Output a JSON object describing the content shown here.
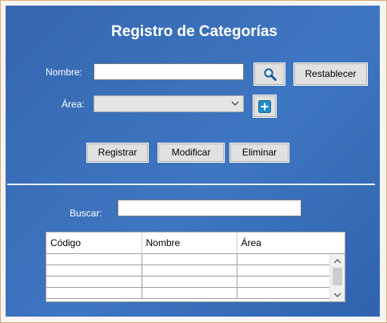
{
  "form": {
    "title": "Registro de Categorías",
    "nombre_label": "Nombre:",
    "nombre_value": "",
    "area_label": "Área:",
    "area_selected": "",
    "buscar_label": "Buscar:",
    "buscar_value": ""
  },
  "buttons": {
    "search_icon": "search-icon",
    "restablecer": "Restablecer",
    "add_icon": "plus-icon",
    "registrar": "Registrar",
    "modificar": "Modificar",
    "eliminar": "Eliminar"
  },
  "grid": {
    "columns": [
      "Código",
      "Nombre",
      "Área"
    ],
    "rows": [
      [
        "",
        "",
        ""
      ],
      [
        "",
        "",
        ""
      ],
      [
        "",
        "",
        ""
      ],
      [
        "",
        "",
        ""
      ]
    ]
  },
  "colors": {
    "panel": "#3a6fba",
    "window_border": "#e4a774",
    "icon_blue": "#1f8dc4"
  }
}
